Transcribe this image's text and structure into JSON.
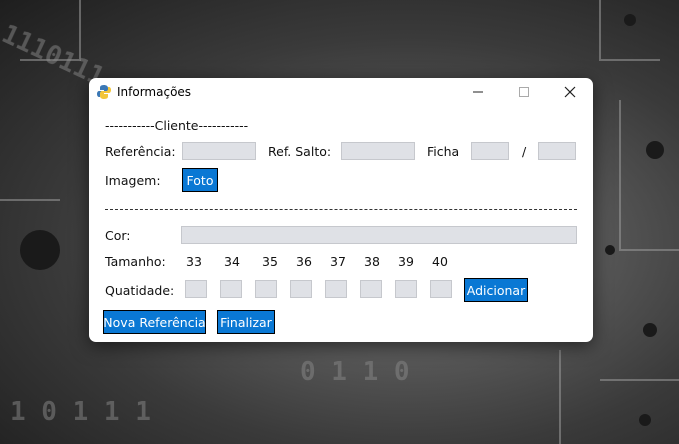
{
  "window": {
    "title": "Informações"
  },
  "cliente": {
    "header": "-----------Cliente-----------",
    "referencia_label": "Referência:",
    "referencia_value": "",
    "ref_salto_label": "Ref. Salto:",
    "ref_salto_value": "",
    "ficha_label": "Ficha",
    "ficha_value_1": "",
    "ficha_separator": "/",
    "ficha_value_2": "",
    "imagem_label": "Imagem:",
    "foto_button": "Foto"
  },
  "produto": {
    "cor_label": "Cor:",
    "cor_value": "",
    "tamanho_label": "Tamanho:",
    "sizes": [
      "33",
      "34",
      "35",
      "36",
      "37",
      "38",
      "39",
      "40"
    ],
    "quantidade_label": "Quatidade:",
    "adicionar_button": "Adicionar"
  },
  "footer": {
    "nova_referencia_button": "Nova Referência",
    "finalizar_button": "Finalizar"
  },
  "colors": {
    "accent": "#0a78d4",
    "entry_bg": "#dfe1e6"
  },
  "icons": {
    "app": "python-logo-icon",
    "minimize": "minimize-icon",
    "maximize": "maximize-icon",
    "close": "close-icon"
  }
}
